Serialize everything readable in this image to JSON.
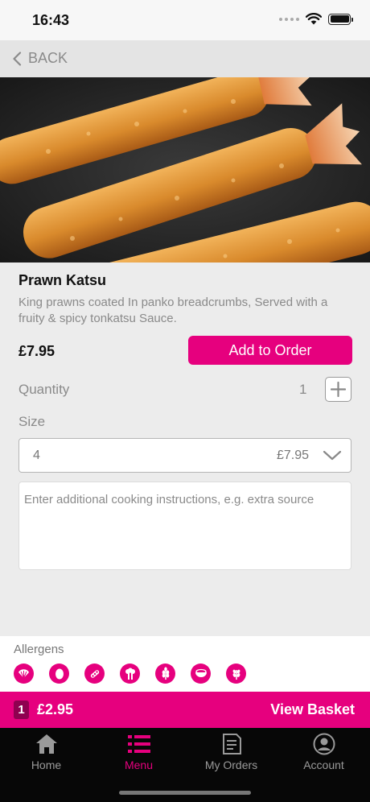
{
  "status_bar": {
    "time": "16:43"
  },
  "nav": {
    "back_label": "BACK"
  },
  "product": {
    "name": "Prawn Katsu",
    "description": "King prawns coated In panko breadcrumbs, Served with a fruity & spicy tonkatsu Sauce.",
    "price": "£7.95",
    "add_button_label": "Add to Order"
  },
  "quantity": {
    "label": "Quantity",
    "value": "1"
  },
  "size": {
    "label": "Size",
    "selected_value": "4",
    "selected_price": "£7.95"
  },
  "instructions": {
    "placeholder": "Enter additional cooking instructions, e.g. extra source"
  },
  "allergens": {
    "title": "Allergens",
    "icons": [
      "shellfish-icon",
      "egg-icon",
      "soya-icon",
      "celery-icon",
      "wheat-icon",
      "sesame-icon",
      "gluten-icon"
    ]
  },
  "basket": {
    "count": "1",
    "total": "£2.95",
    "view_label": "View Basket"
  },
  "tabs": [
    {
      "label": "Home",
      "icon": "home-icon",
      "active": false
    },
    {
      "label": "Menu",
      "icon": "menu-icon",
      "active": true
    },
    {
      "label": "My Orders",
      "icon": "orders-icon",
      "active": false
    },
    {
      "label": "Account",
      "icon": "account-icon",
      "active": false
    }
  ],
  "colors": {
    "brand": "#e6007e",
    "brand_dark": "#8f0150",
    "tab_bar": "#070707",
    "inactive": "#9a9a9a"
  }
}
